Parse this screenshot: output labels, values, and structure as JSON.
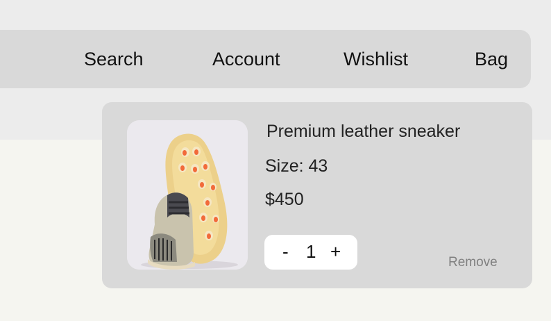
{
  "nav": {
    "search_label": "Search",
    "account_label": "Account",
    "wishlist_label": "Wishlist",
    "bag_label": "Bag"
  },
  "bag_item": {
    "image_alt": "sneaker-product-image",
    "name": "Premium leather sneaker",
    "size": "Size: 43",
    "price": "$450",
    "quantity": "1",
    "decrement_label": "-",
    "increment_label": "+",
    "remove_label": "Remove"
  },
  "colors": {
    "page_background": "#f5f5f0",
    "top_band": "#ececec",
    "panel": "#d9d9d9",
    "stepper": "#ffffff",
    "remove_text": "#808080"
  }
}
